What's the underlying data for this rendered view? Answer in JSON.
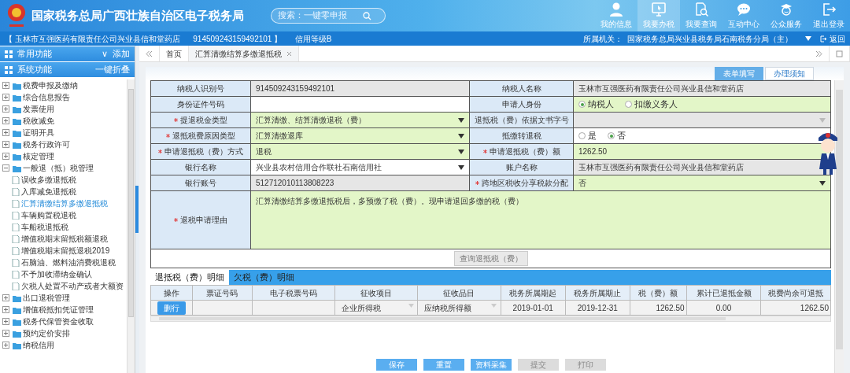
{
  "header": {
    "title": "国家税务总局广西壮族自治区电子税务局",
    "search_placeholder": "搜索：一键零申报",
    "nav": [
      {
        "label": "我的信息",
        "selected": false
      },
      {
        "label": "我要办税",
        "selected": true
      },
      {
        "label": "我要查询",
        "selected": false
      },
      {
        "label": "互动中心",
        "selected": false
      },
      {
        "label": "公众服务",
        "selected": false
      },
      {
        "label": "退出登录",
        "selected": false
      }
    ]
  },
  "info_bar": {
    "company": "【 玉林市互强医药有限责任公司兴业县信和堂药店",
    "tax_id": "914509243159492101 】",
    "credit": "信用等级B",
    "authority_label": "所属机关：",
    "authority": "国家税务总局兴业县税务局石南税务分局（主）",
    "back": "返回"
  },
  "sidebar": {
    "panels": [
      {
        "label": "常用功能",
        "chevron": "∨",
        "action": "添加"
      },
      {
        "label": "系统功能",
        "action": "一键折叠"
      }
    ],
    "tree": [
      {
        "label": "税费申报及缴纳",
        "kind": "folder",
        "expanded": false,
        "selected": false
      },
      {
        "label": "综合信息报告",
        "kind": "folder",
        "expanded": false,
        "selected": false
      },
      {
        "label": "发票使用",
        "kind": "folder",
        "expanded": false,
        "selected": false
      },
      {
        "label": "税收减免",
        "kind": "folder",
        "expanded": false,
        "selected": false
      },
      {
        "label": "证明开具",
        "kind": "folder",
        "expanded": false,
        "selected": false
      },
      {
        "label": "税务行政许可",
        "kind": "folder",
        "expanded": false,
        "selected": false
      },
      {
        "label": "核定管理",
        "kind": "folder",
        "expanded": false,
        "selected": false
      },
      {
        "label": "一般退（抵）税管理",
        "kind": "folder",
        "expanded": true,
        "selected": false,
        "children": [
          {
            "label": "误收多缴退抵税",
            "kind": "page",
            "selected": false
          },
          {
            "label": "入库减免退抵税",
            "kind": "page",
            "selected": false
          },
          {
            "label": "汇算清缴结算多缴退抵税",
            "kind": "page",
            "selected": true
          },
          {
            "label": "车辆购置税退税",
            "kind": "page",
            "selected": false
          },
          {
            "label": "车船税退抵税",
            "kind": "page",
            "selected": false
          },
          {
            "label": "增值税期末留抵税额退税",
            "kind": "page",
            "selected": false
          },
          {
            "label": "增值税期末留抵退税2019",
            "kind": "page",
            "selected": false
          },
          {
            "label": "石脑油、燃料油消费税退税",
            "kind": "page",
            "selected": false
          },
          {
            "label": "不予加收滞纳金确认",
            "kind": "page",
            "selected": false
          },
          {
            "label": "欠税人处置不动产或者大额资",
            "kind": "page",
            "selected": false
          }
        ]
      },
      {
        "label": "出口退税管理",
        "kind": "folder",
        "expanded": false,
        "selected": false
      },
      {
        "label": "增值税抵扣凭证管理",
        "kind": "folder",
        "expanded": false,
        "selected": false
      },
      {
        "label": "税务代保管资金收取",
        "kind": "folder",
        "expanded": false,
        "selected": false
      },
      {
        "label": "预约定价安排",
        "kind": "folder",
        "expanded": false,
        "selected": false
      },
      {
        "label": "纳税信用",
        "kind": "folder",
        "expanded": false,
        "selected": false
      }
    ]
  },
  "tabs": [
    {
      "label": "首页",
      "closable": false,
      "selected": false
    },
    {
      "label": "汇算清缴结算多缴退抵税",
      "closable": true,
      "selected": true
    }
  ],
  "form_tabs": [
    {
      "label": "表单填写",
      "selected": true
    },
    {
      "label": "办理须知",
      "selected": false
    }
  ],
  "form": {
    "rows": [
      [
        {
          "label": "纳税人识别号",
          "required": false,
          "kind": "text",
          "readonly": true,
          "value": "914509243159492101"
        },
        {
          "label": "纳税人名称",
          "required": false,
          "kind": "text",
          "readonly": true,
          "value": "玉林市互强医药有限责任公司兴业县信和堂药店"
        }
      ],
      [
        {
          "label": "身份证件号码",
          "required": false,
          "kind": "text",
          "readonly": false,
          "highlighted": false
        },
        {
          "label": "申请人身份",
          "required": false,
          "kind": "radio",
          "readonly": false,
          "highlighted": true,
          "options": [
            {
              "label": "纳税人",
              "selected": true
            },
            {
              "label": "扣缴义务人",
              "selected": false
            }
          ]
        }
      ],
      [
        {
          "label": "提退税金类型",
          "required": true,
          "kind": "select",
          "readonly": false,
          "highlighted": true,
          "value": "汇算清缴、结算清缴退税（费）"
        },
        {
          "label": "退抵税（费）依据文书字号",
          "required": false,
          "kind": "select",
          "readonly": true
        }
      ],
      [
        {
          "label": "退抵税费原因类型",
          "required": true,
          "kind": "select",
          "readonly": false,
          "highlighted": true,
          "value": "汇算清缴退库"
        },
        {
          "label": "抵缴转退税",
          "required": false,
          "kind": "radio",
          "readonly": false,
          "highlighted": false,
          "options": [
            {
              "label": "是",
              "selected": false
            },
            {
              "label": "否",
              "selected": true
            }
          ]
        }
      ],
      [
        {
          "label": "申请退抵税（费）方式",
          "required": true,
          "kind": "select",
          "readonly": false,
          "highlighted": true,
          "value": "退税"
        },
        {
          "label": "申请退抵税（费）额",
          "required": true,
          "kind": "text",
          "readonly": false,
          "highlighted": true,
          "value": "1262.50"
        }
      ],
      [
        {
          "label": "银行名称",
          "required": false,
          "kind": "select",
          "readonly": false,
          "highlighted": false,
          "value": "兴业县农村信用合作联社石南信用社"
        },
        {
          "label": "账户名称",
          "required": false,
          "kind": "text",
          "readonly": true,
          "value": "玉林市互强医药有限责任公司兴业县信和堂药店"
        }
      ],
      [
        {
          "label": "银行账号",
          "required": false,
          "kind": "text",
          "readonly": true,
          "value": "512712010113808223"
        },
        {
          "label": "跨地区税收分享税款分配",
          "required": true,
          "kind": "select",
          "readonly": false,
          "highlighted": true,
          "value": "否"
        }
      ],
      [
        {
          "label": "退税申请理由",
          "required": true,
          "kind": "textarea",
          "readonly": false,
          "highlighted": true,
          "value": "汇算清缴结算多缴退抵税后，多预缴了税（费）。现申请退回多缴的税（费）"
        }
      ]
    ],
    "query_button": {
      "label": "查询退抵税（费）",
      "disabled": true
    }
  },
  "detail_tabs": [
    {
      "label": "退抵税（费）明细",
      "selected": true
    },
    {
      "label": "欠税（费）明细",
      "selected": false
    }
  ],
  "detail_table": {
    "columns": [
      "操作",
      "票证号码",
      "电子税票号码",
      "征收项目",
      "征收品目",
      "税务所属期起",
      "税务所属期止",
      "税（费）额",
      "累计已退抵金额",
      "税费尚余可退抵"
    ],
    "rows": [
      [
        {
          "kind": "button",
          "value": "删行"
        },
        {
          "kind": "text"
        },
        {
          "kind": "text"
        },
        {
          "kind": "select",
          "value": "企业所得税"
        },
        {
          "kind": "select",
          "value": "应纳税所得额"
        },
        {
          "kind": "text",
          "value": "2019-01-01"
        },
        {
          "kind": "text",
          "value": "2019-12-31"
        },
        {
          "kind": "number",
          "value": "1262.50"
        },
        {
          "kind": "text",
          "value": "0.00"
        },
        {
          "kind": "number",
          "value": "1262.50"
        }
      ]
    ]
  },
  "actions": [
    {
      "label": "保存",
      "disabled": false
    },
    {
      "label": "重置",
      "disabled": false
    },
    {
      "label": "资料采集",
      "disabled": false
    },
    {
      "label": "提交",
      "disabled": true
    },
    {
      "label": "打印",
      "disabled": true
    }
  ]
}
